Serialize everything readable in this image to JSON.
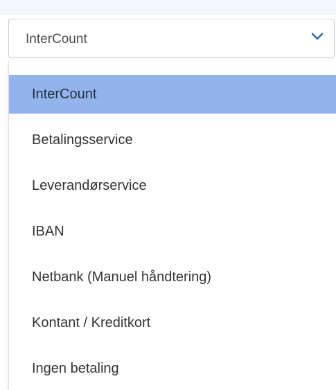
{
  "select": {
    "value": "InterCount",
    "icon": "chevron-down-icon"
  },
  "colors": {
    "selected_bg": "#92b4ea",
    "chevron": "#2f5fa6",
    "border": "#c9cdd3"
  },
  "options": [
    {
      "label": "InterCount",
      "selected": true
    },
    {
      "label": "Betalingsservice",
      "selected": false
    },
    {
      "label": "Leverandørservice",
      "selected": false
    },
    {
      "label": "IBAN",
      "selected": false
    },
    {
      "label": "Netbank (Manuel håndtering)",
      "selected": false
    },
    {
      "label": "Kontant / Kreditkort",
      "selected": false
    },
    {
      "label": "Ingen betaling",
      "selected": false
    }
  ]
}
